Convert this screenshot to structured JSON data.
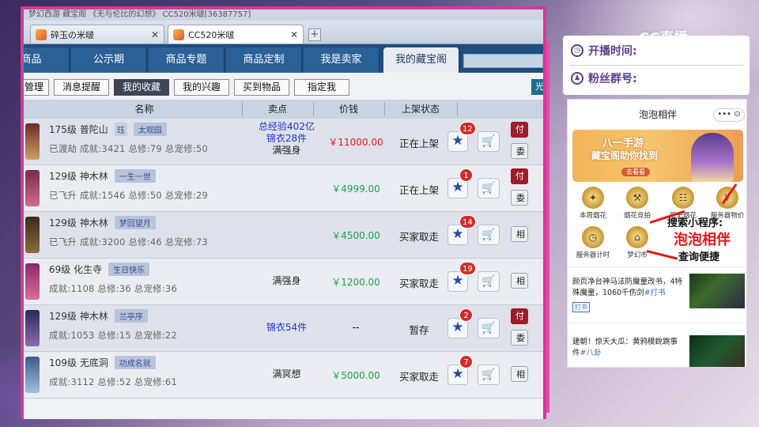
{
  "browser": {
    "top_text": "梦幻西游 藏宝阁   《无与伦比的幻想》  CC520米啵[36387757]",
    "tabs": [
      {
        "label": "碎玉の米啵"
      },
      {
        "label": "CC520米啵"
      }
    ],
    "new_tab": "+"
  },
  "nav": {
    "tabs": [
      "商品",
      "公示期",
      "商品专题",
      "商品定制",
      "我是卖家",
      "我的藏宝阁"
    ],
    "active": "我的藏宝阁"
  },
  "subnav": {
    "buttons": [
      "管理",
      "消息提醒",
      "我的收藏",
      "我的兴趣",
      "买到物品",
      "指定我"
    ],
    "active": "我的收藏",
    "right_label": "光"
  },
  "table": {
    "headers": [
      "名称",
      "卖点",
      "价钱",
      "上架状态"
    ],
    "rows": [
      {
        "name": "175级 普陀山",
        "tags": [
          "珏",
          "太观园"
        ],
        "detail": "已渡劫 成就:3421 总修:79 总宠修:50",
        "selling": [
          "总经验402亿",
          "锦衣28件",
          "满强身"
        ],
        "price": "￥11000.00",
        "price_color": "red",
        "status": "正在上架",
        "fav_count": "12",
        "actions": [
          "付",
          "委"
        ],
        "action_style": "red"
      },
      {
        "name": "129级 神木林",
        "tags": [
          "一生一世"
        ],
        "detail": "已飞升 成就:1546 总修:50 总宠修:29",
        "selling": [],
        "price": "￥4999.00",
        "price_color": "green",
        "status": "正在上架",
        "fav_count": "1",
        "actions": [
          "付",
          "委"
        ],
        "action_style": "red"
      },
      {
        "name": "129级 神木林",
        "tags": [
          "梦回望月"
        ],
        "detail": "已飞升 成就:3200 总修:46 总宠修:73",
        "selling": [],
        "price": "￥4500.00",
        "price_color": "green",
        "status": "买家取走",
        "fav_count": "14",
        "actions": [
          "相"
        ],
        "action_style": "gray"
      },
      {
        "name": "69级 化生寺",
        "tags": [
          "生日快乐"
        ],
        "detail": "成就:1108 总修:36 总宠修:36",
        "selling": [
          "满强身"
        ],
        "price": "￥1200.00",
        "price_color": "green",
        "status": "买家取走",
        "fav_count": "19",
        "actions": [
          "相"
        ],
        "action_style": "gray"
      },
      {
        "name": "129级 神木林",
        "tags": [
          "兰亭序"
        ],
        "detail": "成就:1053 总修:15 总宠修:22",
        "selling": [
          "锦衣54件"
        ],
        "price": "--",
        "price_color": "dark",
        "status": "暂存",
        "fav_count": "2",
        "actions": [
          "付",
          "委"
        ],
        "action_style": "red"
      },
      {
        "name": "109级 无底洞",
        "tags": [
          "功成名就"
        ],
        "detail": "成就:3112 总修:52 总宠修:61",
        "selling": [
          "满冥想"
        ],
        "price": "￥5000.00",
        "price_color": "green",
        "status": "买家取走",
        "fav_count": "7",
        "actions": [
          "相"
        ],
        "action_style": "gray"
      }
    ]
  },
  "side": {
    "cc_logo": "CC直播",
    "start_time_label": "开播时间:",
    "fans_label": "粉丝群号:",
    "mini_title": "泡泡相伴",
    "mini_ctl": "•••  ⊙",
    "banner_line1": "八一手游",
    "banner_line2": "藏宝阁助你找到",
    "banner_btn": "去看看",
    "grid": [
      "本周烟花",
      "烟花竞拍",
      "历史烟花",
      "服务器物价",
      "服务器计时",
      "梦幻市"
    ],
    "promo1": "搜索小程序:",
    "promo2": "泡泡相伴",
    "promo3": "查询便捷",
    "news1": "颜页净台神马法防魔童改书，4特殊魔童，1060千伤剑",
    "news1_hl": "#打书",
    "news1_tag": "打书",
    "news2": "建朝！惊天大瓜：黄鸦模銳跳事件",
    "news2_hl": "#八卦"
  }
}
